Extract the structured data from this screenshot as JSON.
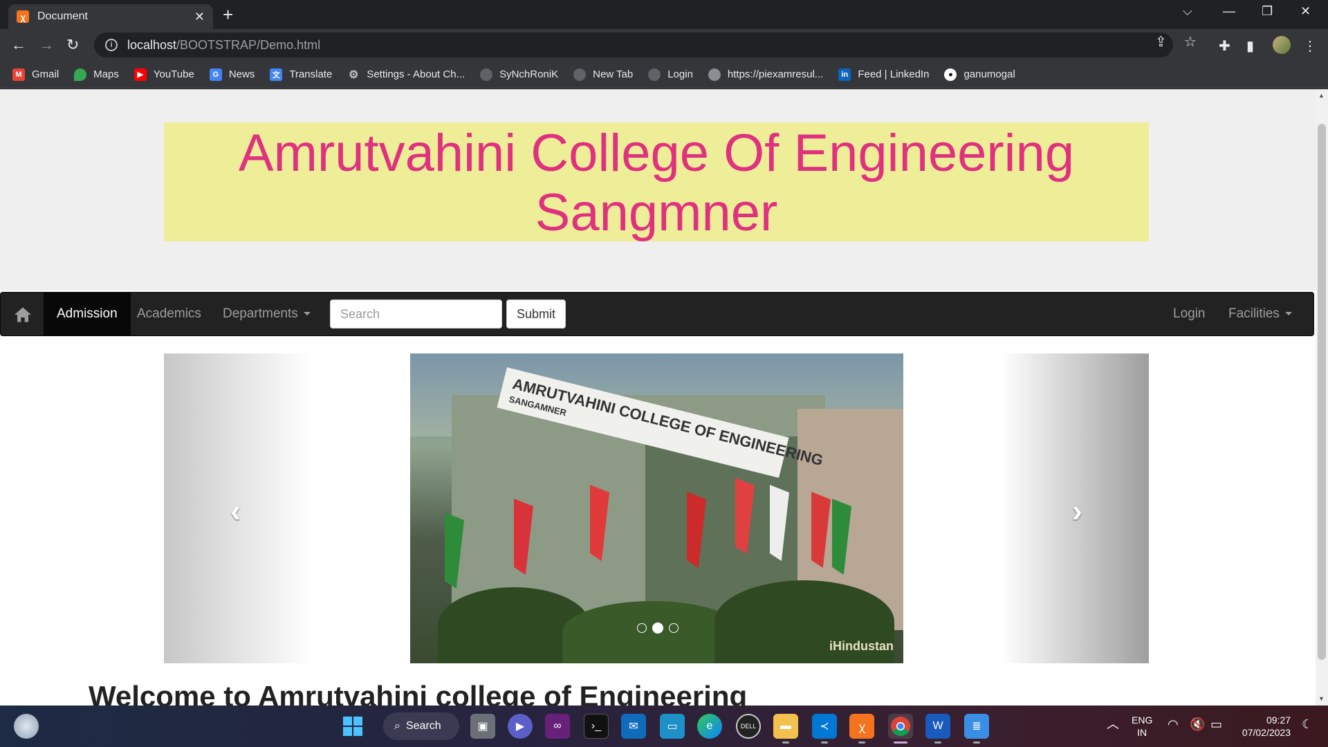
{
  "browser": {
    "tab_title": "Document",
    "url_host": "localhost",
    "url_path": "/BOOTSTRAP/Demo.html",
    "bookmarks": [
      "Gmail",
      "Maps",
      "YouTube",
      "News",
      "Translate",
      "Settings - About Ch...",
      "SyNchRoniK",
      "New Tab",
      "Login",
      "https://piexamresul...",
      "Feed | LinkedIn",
      "ganumogal"
    ]
  },
  "page": {
    "jumbotron_line1": "Amrutvahini College Of Engineering",
    "jumbotron_line2": "Sangmner",
    "navbar": {
      "items": [
        "Admission",
        "Academics",
        "Departments"
      ],
      "right_items": [
        "Login",
        "Facilities"
      ],
      "search_placeholder": "Search",
      "submit_label": "Submit"
    },
    "carousel": {
      "sign_text": "AMRUTVAHINI COLLEGE OF ENGINEERING",
      "sign_subtext": "SANGAMNER",
      "watermark": "iHindustan",
      "active_index": 1,
      "slide_count": 3
    },
    "welcome_heading": "Welcome to Amrutvahini college of Engineering"
  },
  "taskbar": {
    "search_label": "Search",
    "lang_line1": "ENG",
    "lang_line2": "IN",
    "time": "09:27",
    "date": "07/02/2023"
  }
}
